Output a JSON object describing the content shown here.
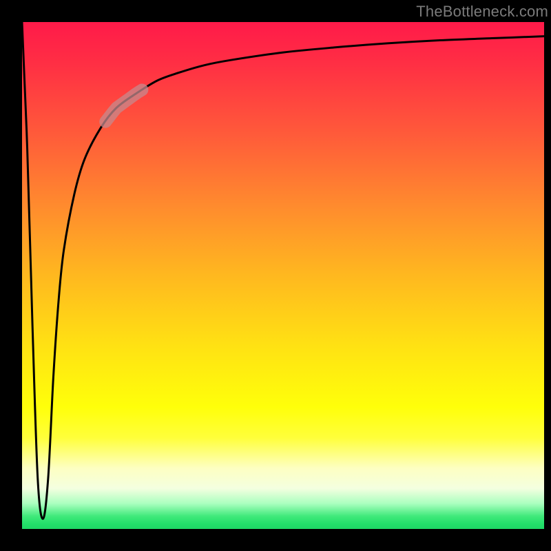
{
  "watermark": "TheBottleneck.com",
  "chart_data": {
    "type": "line",
    "title": "",
    "xlabel": "",
    "ylabel": "",
    "xlim": [
      0,
      100
    ],
    "ylim": [
      0,
      100
    ],
    "grid": false,
    "legend": false,
    "series": [
      {
        "name": "bottleneck-curve",
        "x": [
          0,
          1,
          2,
          3,
          4,
          5,
          6,
          7,
          8,
          10,
          12,
          15,
          18,
          22,
          26,
          30,
          35,
          40,
          50,
          60,
          70,
          80,
          90,
          100
        ],
        "y": [
          100,
          75,
          40,
          10,
          2,
          10,
          30,
          45,
          55,
          66,
          73,
          79,
          83,
          86,
          88.5,
          90,
          91.5,
          92.5,
          94,
          95,
          95.8,
          96.4,
          96.8,
          97.2
        ]
      }
    ],
    "highlight_segment": {
      "series": "bottleneck-curve",
      "x_start": 16,
      "x_end": 23
    },
    "background_gradient": {
      "orientation": "vertical",
      "stops": [
        {
          "pos": 0.0,
          "color": "#ff1a49"
        },
        {
          "pos": 0.5,
          "color": "#ffb81f"
        },
        {
          "pos": 0.76,
          "color": "#ffff0a"
        },
        {
          "pos": 0.97,
          "color": "#3fe97a"
        },
        {
          "pos": 1.0,
          "color": "#1fd765"
        }
      ]
    }
  }
}
